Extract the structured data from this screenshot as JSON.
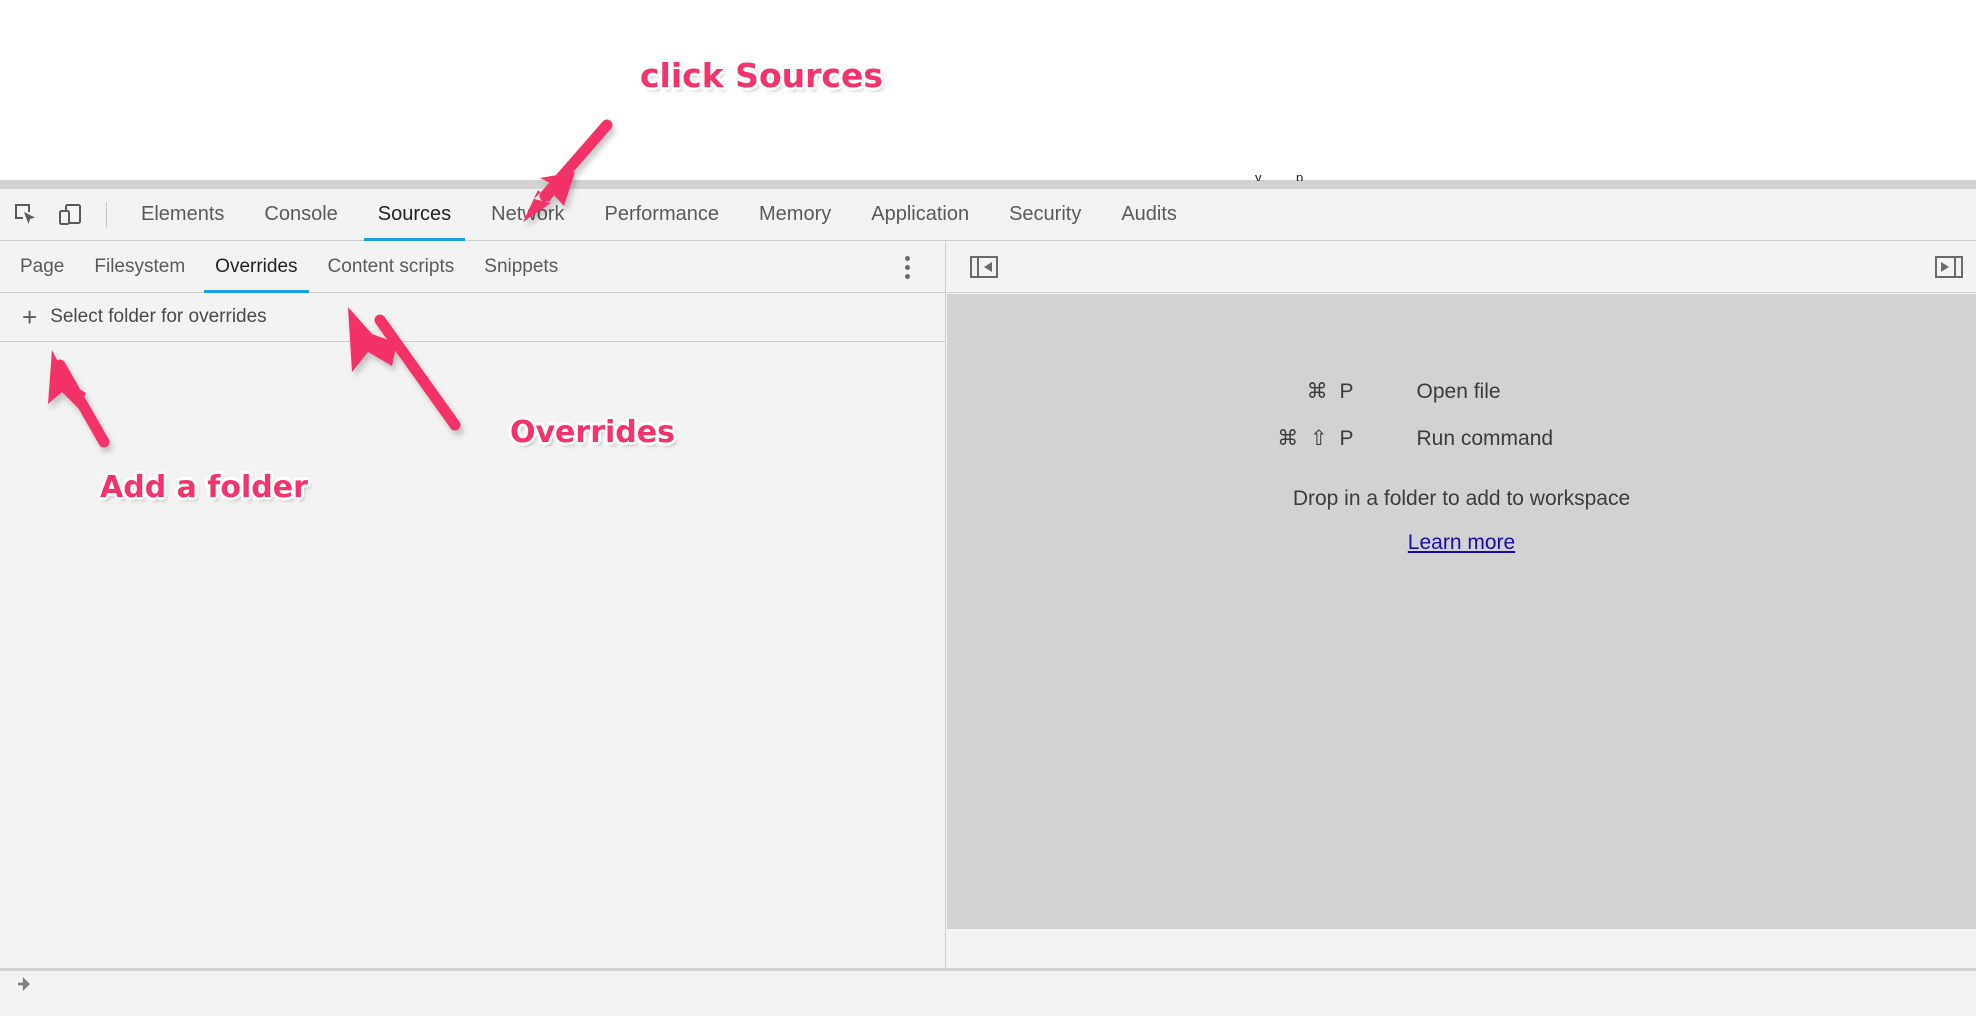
{
  "browser": {
    "clipped_page_text": [
      "y",
      "p"
    ]
  },
  "devtools": {
    "toolbar_icons": [
      {
        "name": "inspect-element-icon",
        "label": "Inspect element"
      },
      {
        "name": "device-toolbar-icon",
        "label": "Toggle device toolbar"
      }
    ],
    "main_tabs": [
      {
        "label": "Elements",
        "selected": false
      },
      {
        "label": "Console",
        "selected": false
      },
      {
        "label": "Sources",
        "selected": true
      },
      {
        "label": "Network",
        "selected": false
      },
      {
        "label": "Performance",
        "selected": false
      },
      {
        "label": "Memory",
        "selected": false
      },
      {
        "label": "Application",
        "selected": false
      },
      {
        "label": "Security",
        "selected": false
      },
      {
        "label": "Audits",
        "selected": false
      }
    ],
    "sub_tabs": [
      {
        "label": "Page",
        "selected": false
      },
      {
        "label": "Filesystem",
        "selected": false
      },
      {
        "label": "Overrides",
        "selected": true
      },
      {
        "label": "Content scripts",
        "selected": false
      },
      {
        "label": "Snippets",
        "selected": false
      }
    ],
    "more_menu_label": "More tabs",
    "navigator": {
      "plus_glyph": "+",
      "select_folder_label": "Select folder for overrides"
    },
    "editor": {
      "collapse_left_label": "Show navigator",
      "collapse_right_label": "Show debugger",
      "shortcuts": [
        {
          "keys": "⌘ P",
          "description": "Open file"
        },
        {
          "keys": "⌘ ⇧ P",
          "description": "Run command"
        }
      ],
      "drop_hint": "Drop in a folder to add to workspace",
      "learn_more_label": "Learn more"
    }
  },
  "annotations": {
    "accent_color": "#f4336b",
    "items": [
      {
        "id": "click-sources",
        "text": "click Sources"
      },
      {
        "id": "add-a-folder",
        "text": "Add a folder"
      },
      {
        "id": "overrides",
        "text": "Overrides"
      }
    ]
  },
  "colors": {
    "accent_blue": "#1a9ee0",
    "link_blue": "#1a0dab",
    "panel_bg": "#f3f3f3",
    "editor_placeholder_bg": "#d2d2d2",
    "annotation_pink": "#f4336b"
  }
}
